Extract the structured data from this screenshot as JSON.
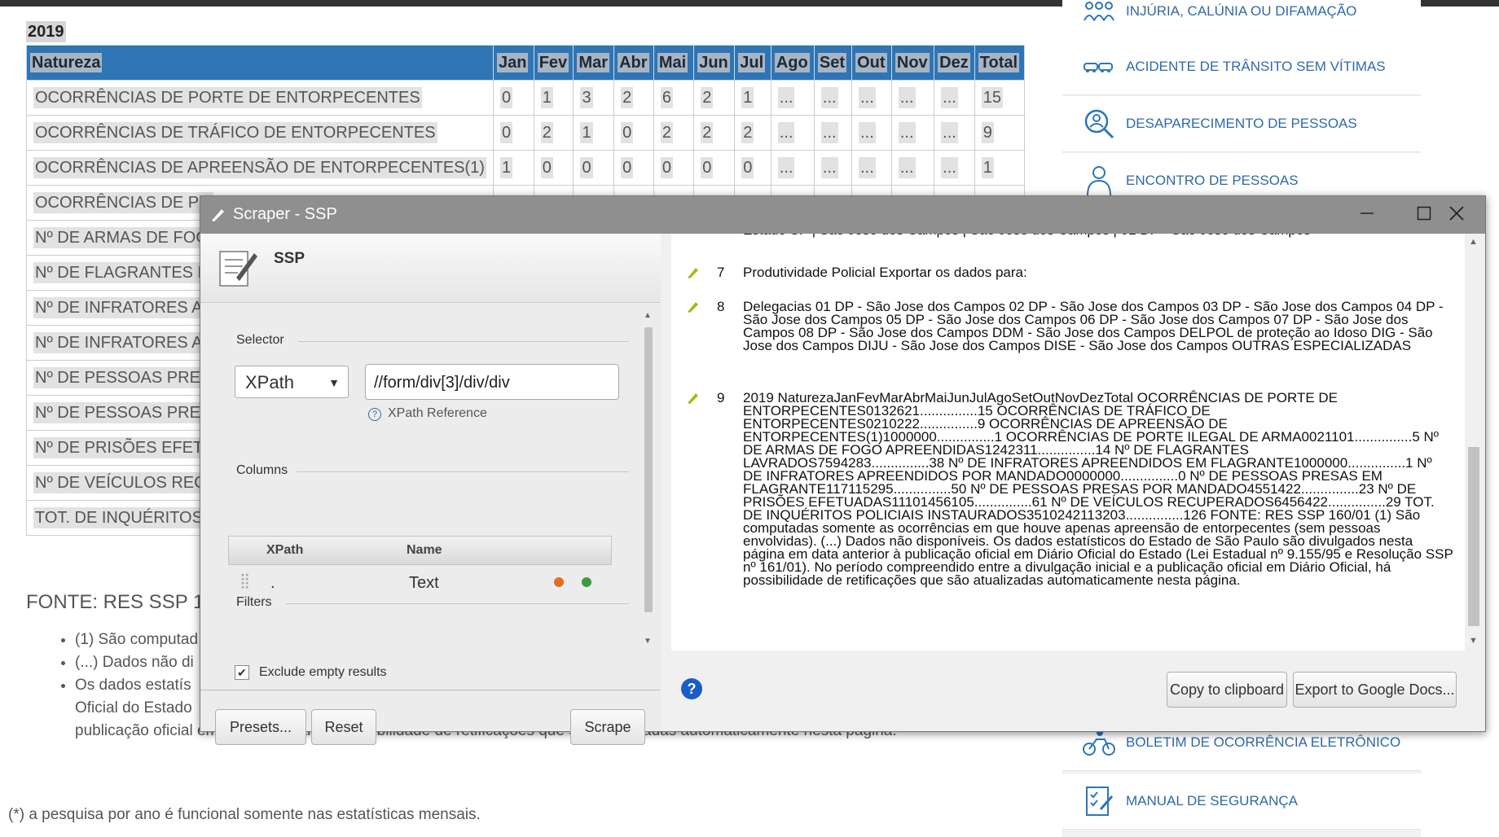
{
  "page": {
    "year": "2019",
    "table": {
      "headers": [
        "Natureza",
        "Jan",
        "Fev",
        "Mar",
        "Abr",
        "Mai",
        "Jun",
        "Jul",
        "Ago",
        "Set",
        "Out",
        "Nov",
        "Dez",
        "Total"
      ],
      "rows": [
        [
          "OCORRÊNCIAS DE PORTE DE ENTORPECENTES",
          "0",
          "1",
          "3",
          "2",
          "6",
          "2",
          "1",
          "...",
          "...",
          "...",
          "...",
          "...",
          "15"
        ],
        [
          "OCORRÊNCIAS DE TRÁFICO DE ENTORPECENTES",
          "0",
          "2",
          "1",
          "0",
          "2",
          "2",
          "2",
          "...",
          "...",
          "...",
          "...",
          "...",
          "9"
        ],
        [
          "OCORRÊNCIAS DE APREENSÃO DE ENTORPECENTES(1)",
          "1",
          "0",
          "0",
          "0",
          "0",
          "0",
          "0",
          "...",
          "...",
          "...",
          "...",
          "...",
          "1"
        ],
        [
          "OCORRÊNCIAS DE PO"
        ],
        [
          "Nº DE ARMAS DE FOG"
        ],
        [
          "Nº DE FLAGRANTES L"
        ],
        [
          "Nº DE INFRATORES A"
        ],
        [
          "Nº DE INFRATORES A"
        ],
        [
          "Nº DE PESSOAS PRES"
        ],
        [
          "Nº DE PESSOAS PRES"
        ],
        [
          "Nº DE PRISÕES EFETU"
        ],
        [
          "Nº DE VEÍCULOS REC"
        ],
        [
          "TOT. DE INQUÉRITOS"
        ]
      ]
    },
    "fonte": "FONTE: RES SSP 1",
    "notes": [
      "(1) São computad",
      "(...) Dados não di",
      "Os dados estatís",
      "Oficial do Estado",
      "publicação oficial em Diário Oficial, há possibilidade de retificações que são atualizadas automaticamente nesta página."
    ],
    "footnote": "(*) a pesquisa por ano é funcional somente nas estatísticas mensais."
  },
  "sidebar": {
    "items": [
      {
        "label": "INJÚRIA, CALÚNIA OU DIFAMAÇÃO",
        "icon": "people-icon"
      },
      {
        "label": "ACIDENTE DE TRÂNSITO SEM VÍTIMAS",
        "icon": "cars-icon"
      },
      {
        "label": "DESAPARECIMENTO DE PESSOAS",
        "icon": "person-search-icon"
      },
      {
        "label": "ENCONTRO DE PESSOAS",
        "icon": "person-icon"
      },
      {
        "label": "BOLETIM DE OCORRÊNCIA ELETRÔNICO",
        "icon": "motorcycle-icon"
      },
      {
        "label": "MANUAL DE SEGURANÇA",
        "icon": "checklist-icon"
      }
    ]
  },
  "scraper": {
    "title": "Scraper - SSP",
    "name": "SSP",
    "selector_label": "Selector",
    "selector_type": "XPath",
    "xpath": "//form/div[3]/div/div",
    "xpath_reference": "XPath Reference",
    "columns_label": "Columns",
    "col_headers": {
      "xpath": "XPath",
      "name": "Name"
    },
    "column": {
      "xpath": ".",
      "name": "Text"
    },
    "filters_label": "Filters",
    "exclude_empty": "Exclude empty results",
    "buttons": {
      "presets": "Presets...",
      "reset": "Reset",
      "scrape": "Scrape",
      "copy": "Copy to clipboard",
      "export": "Export to Google Docs..."
    },
    "results": [
      {
        "num": "7",
        "text": "Produtividade Policial Exportar os dados para:"
      },
      {
        "num": "8",
        "text": "Delegacias 01 DP - São Jose dos Campos 02 DP - São Jose dos Campos 03 DP - São Jose dos Campos 04 DP - São Jose dos Campos 05 DP - São Jose dos Campos 06 DP - São Jose dos Campos 07 DP - São Jose dos Campos 08 DP - São Jose dos Campos DDM - São Jose dos Campos DELPOL de proteção ao Idoso DIG - São Jose dos Campos DIJU - São Jose dos Campos DISE - São Jose dos Campos OUTRAS ESPECIALIZADAS"
      },
      {
        "num": "9",
        "text": "2019 NaturezaJanFevMarAbrMaiJunJulAgoSetOutNovDezTotal OCORRÊNCIAS DE PORTE DE ENTORPECENTES0132621...............15 OCORRÊNCIAS DE TRÁFICO DE ENTORPECENTES0210222...............9 OCORRÊNCIAS DE APREENSÃO DE ENTORPECENTES(1)1000000...............1 OCORRÊNCIAS DE PORTE ILEGAL DE ARMA0021101...............5 Nº DE ARMAS DE FOGO APREENDIDAS1242311...............14 Nº DE FLAGRANTES LAVRADOS7594283...............38 Nº DE INFRATORES APREENDIDOS EM FLAGRANTE1000000...............1 Nº DE INFRATORES APREENDIDOS POR MANDADO0000000...............0 Nº DE PESSOAS PRESAS EM FLAGRANTE117115295...............50 Nº DE PESSOAS PRESAS POR MANDADO4551422...............23 Nº DE PRISÕES EFETUADAS11101456105...............61 Nº DE VEÍCULOS RECUPERADOS6456422...............29 TOT. DE INQUÉRITOS POLICIAIS INSTAURADOS3510242113203...............126 FONTE: RES SSP 160/01 (1) São computadas somente as ocorrências em que houve apenas apreensão de entorpecentes (sem pessoas envolvidas). (...) Dados não disponíveis. Os dados estatísticos do Estado de São Paulo são divulgados nesta página em data anterior à publicação oficial em Diário Oficial do Estado (Lei Estadual nº 9.155/95 e Resolução SSP nº 161/01). No período compreendido entre a divulgação inicial e a publicação oficial em Diário Oficial, há possibilidade de retificações que são atualizadas automaticamente nesta página."
      }
    ]
  },
  "colors": {
    "header_blue": "#2e75b6",
    "titlebar": "#8f8f8f",
    "link_blue": "#2e6aa8",
    "help_blue": "#1a5dc9"
  }
}
